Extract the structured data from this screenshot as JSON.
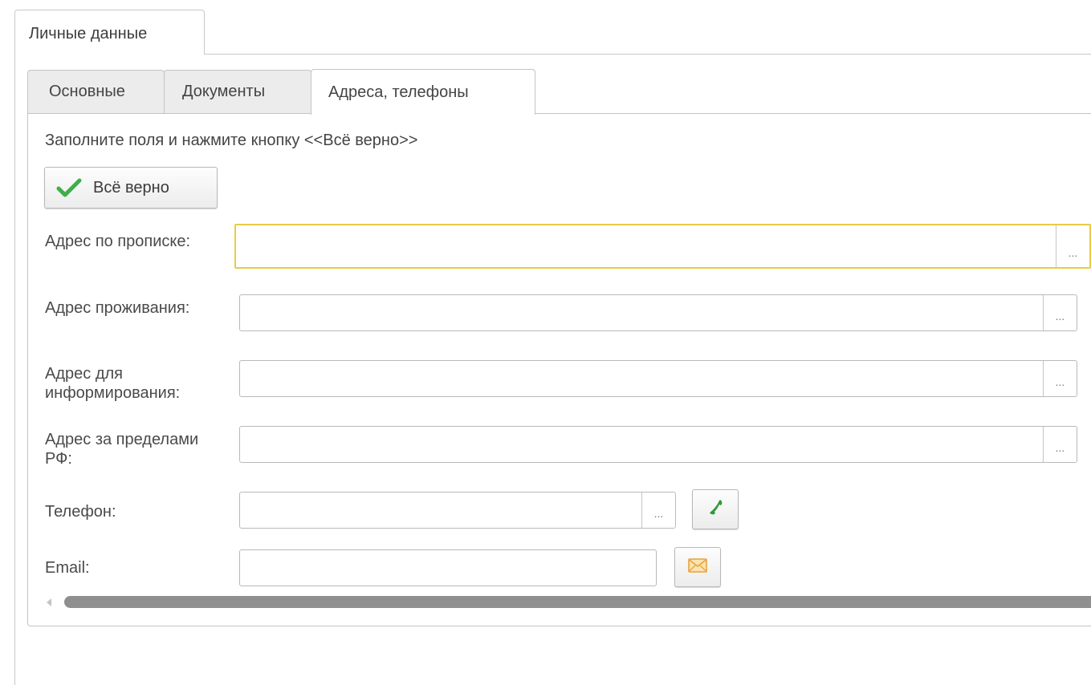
{
  "outer_tab": {
    "label": "Личные данные"
  },
  "inner_tabs": [
    {
      "label": "Основные",
      "active": false
    },
    {
      "label": "Документы",
      "active": false
    },
    {
      "label": "Адреса, телефоны",
      "active": true
    }
  ],
  "hint": "Заполните поля и нажмите кнопку <<Всё верно>>",
  "ok_button": {
    "label": "Всё верно"
  },
  "fields": {
    "registration_address": {
      "label": "Адрес по прописке:",
      "value": ""
    },
    "residence_address": {
      "label": "Адрес проживания:",
      "value": ""
    },
    "info_address": {
      "label": "Адрес для информирования:",
      "value": ""
    },
    "foreign_address": {
      "label": "Адрес за пределами РФ:",
      "value": ""
    },
    "phone": {
      "label": "Телефон:",
      "value": ""
    },
    "email": {
      "label": "Email:",
      "value": ""
    }
  },
  "dots_label": "...",
  "icons": {
    "ok": "check-icon",
    "phone": "phone-icon",
    "email": "envelope-icon",
    "scroll_left": "scroll-left-arrow-icon"
  },
  "colors": {
    "check": "#3fae49",
    "phone": "#2e9a3a",
    "focus_border": "#e8cc45",
    "envelope": "#e8a33c"
  }
}
